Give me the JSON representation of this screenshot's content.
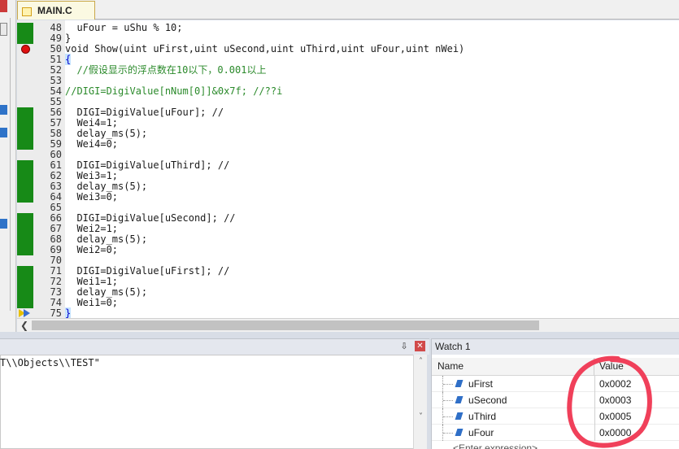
{
  "editor": {
    "tab_label": "MAIN.C",
    "lines": [
      {
        "num": "48",
        "text": "  uFour = uShu % 10;",
        "cov": true,
        "kind": "code"
      },
      {
        "num": "49",
        "text": "}",
        "cov": true,
        "kind": "code"
      },
      {
        "num": "50",
        "text": "void Show(uint uFirst,uint uSecond,uint uThird,uint uFour,uint nWei)",
        "cov": false,
        "kind": "code",
        "breakpoint": true
      },
      {
        "num": "51",
        "text": "{",
        "cov": false,
        "kind": "brace"
      },
      {
        "num": "52",
        "text": "  //假设显示的浮点数在10以下，0.001以上",
        "cov": false,
        "kind": "comment"
      },
      {
        "num": "53",
        "text": "",
        "cov": false,
        "kind": "code"
      },
      {
        "num": "54",
        "text": "//DIGI=DigiValue[nNum[0]]&0x7f; //??i",
        "cov": false,
        "kind": "comment"
      },
      {
        "num": "55",
        "text": "",
        "cov": false,
        "kind": "code"
      },
      {
        "num": "56",
        "text": "  DIGI=DigiValue[uFour]; //",
        "cov": true,
        "kind": "code"
      },
      {
        "num": "57",
        "text": "  Wei4=1;",
        "cov": true,
        "kind": "code"
      },
      {
        "num": "58",
        "text": "  delay_ms(5);",
        "cov": true,
        "kind": "code"
      },
      {
        "num": "59",
        "text": "  Wei4=0;",
        "cov": true,
        "kind": "code"
      },
      {
        "num": "60",
        "text": "",
        "cov": false,
        "kind": "code"
      },
      {
        "num": "61",
        "text": "  DIGI=DigiValue[uThird]; //",
        "cov": true,
        "kind": "code"
      },
      {
        "num": "62",
        "text": "  Wei3=1;",
        "cov": true,
        "kind": "code"
      },
      {
        "num": "63",
        "text": "  delay_ms(5);",
        "cov": true,
        "kind": "code"
      },
      {
        "num": "64",
        "text": "  Wei3=0;",
        "cov": true,
        "kind": "code"
      },
      {
        "num": "65",
        "text": "",
        "cov": false,
        "kind": "code"
      },
      {
        "num": "66",
        "text": "  DIGI=DigiValue[uSecond]; //",
        "cov": true,
        "kind": "code"
      },
      {
        "num": "67",
        "text": "  Wei2=1;",
        "cov": true,
        "kind": "code"
      },
      {
        "num": "68",
        "text": "  delay_ms(5);",
        "cov": true,
        "kind": "code"
      },
      {
        "num": "69",
        "text": "  Wei2=0;",
        "cov": true,
        "kind": "code"
      },
      {
        "num": "70",
        "text": "",
        "cov": false,
        "kind": "code"
      },
      {
        "num": "71",
        "text": "  DIGI=DigiValue[uFirst]; //",
        "cov": true,
        "kind": "code"
      },
      {
        "num": "72",
        "text": "  Wei1=1;",
        "cov": true,
        "kind": "code"
      },
      {
        "num": "73",
        "text": "  delay_ms(5);",
        "cov": true,
        "kind": "code"
      },
      {
        "num": "74",
        "text": "  Wei1=0;",
        "cov": true,
        "kind": "code"
      },
      {
        "num": "75",
        "text": "}",
        "cov": false,
        "kind": "brace",
        "current": true
      }
    ]
  },
  "output": {
    "text": "T\\\\Objects\\\\TEST\""
  },
  "watch": {
    "title": "Watch 1",
    "col_name": "Name",
    "col_value": "Value",
    "rows": [
      {
        "name": "uFirst",
        "value": "0x0002"
      },
      {
        "name": "uSecond",
        "value": "0x0003"
      },
      {
        "name": "uThird",
        "value": "0x0005"
      },
      {
        "name": "uFour",
        "value": "0x0000"
      }
    ],
    "enter_expression": "<Enter expression>"
  },
  "colors": {
    "coverage": "#178a17",
    "breakpoint": "#e01010",
    "annotation": "#f0405a"
  },
  "icons": [
    "file-icon",
    "breakpoint-icon",
    "current-line-arrow-icon",
    "pin-icon",
    "close-icon",
    "variable-icon",
    "scroll-left-icon",
    "scroll-up-icon",
    "scroll-down-icon"
  ]
}
